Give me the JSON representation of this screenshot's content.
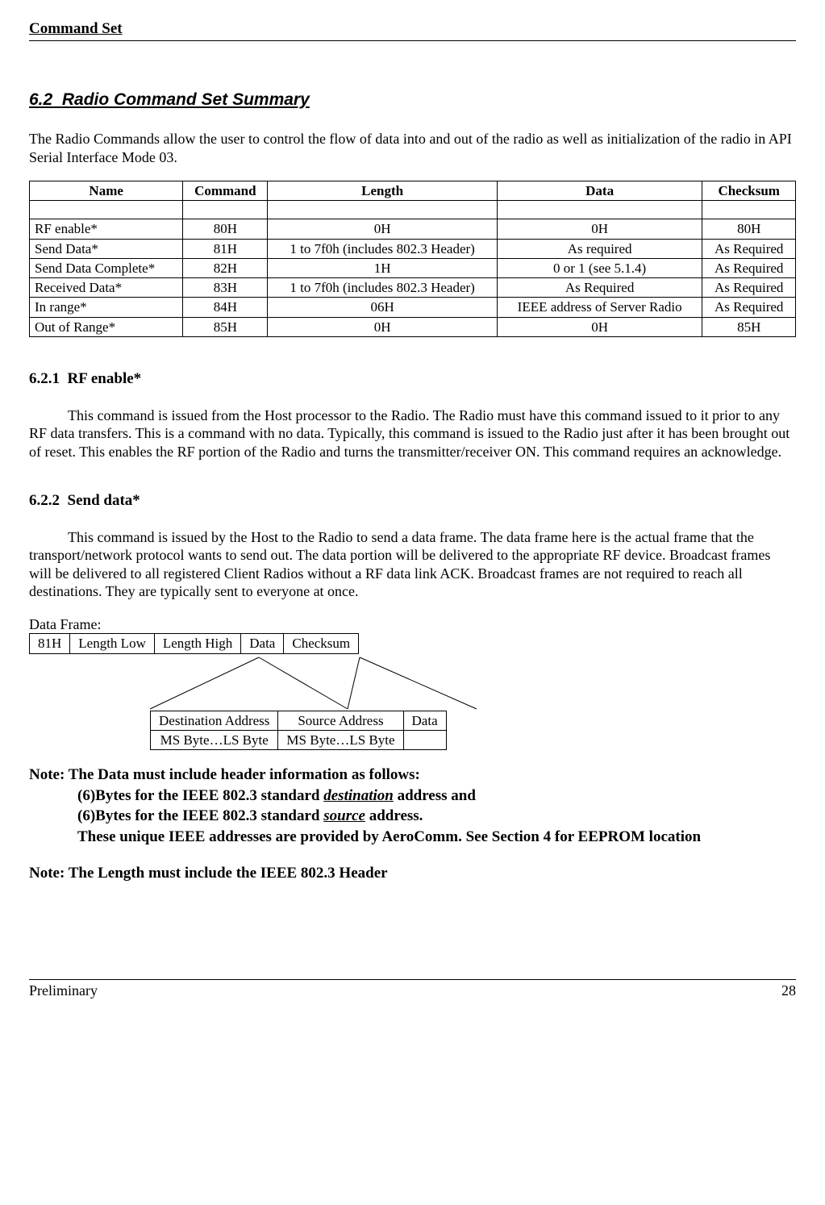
{
  "header": {
    "title": "Command Set"
  },
  "section": {
    "number": "6.2",
    "title": "Radio Command Set Summary",
    "intro": "The Radio Commands allow the user to control the flow of data into and out of the radio as well as initialization of the radio in API Serial Interface Mode 03."
  },
  "table": {
    "headers": [
      "Name",
      "Command",
      "Length",
      "Data",
      "Checksum"
    ],
    "rows": [
      {
        "name": "RF enable*",
        "command": "80H",
        "length": "0H",
        "data": "0H",
        "checksum": "80H"
      },
      {
        "name": "Send Data*",
        "command": "81H",
        "length": "1 to 7f0h (includes 802.3 Header)",
        "data": "As required",
        "checksum": "As Required"
      },
      {
        "name": "Send Data Complete*",
        "command": "82H",
        "length": "1H",
        "data": "0 or 1 (see 5.1.4)",
        "checksum": "As Required"
      },
      {
        "name": "Received Data*",
        "command": "83H",
        "length": "1 to 7f0h (includes 802.3 Header)",
        "data": "As Required",
        "checksum": "As Required"
      },
      {
        "name": "In range*",
        "command": "84H",
        "length": "06H",
        "data": "IEEE address of Server Radio",
        "checksum": "As Required"
      },
      {
        "name": "Out of Range*",
        "command": "85H",
        "length": "0H",
        "data": "0H",
        "checksum": "85H"
      }
    ]
  },
  "sub1": {
    "number": "6.2.1",
    "title": "RF enable*",
    "body": "This command is issued from the Host processor to the Radio. The Radio must have this command issued to it prior to any RF data transfers.  This is a command with no data. Typically, this command is issued to the Radio just after it has been brought out of reset. This enables the RF portion of the Radio and turns the transmitter/receiver ON. This command requires an acknowledge."
  },
  "sub2": {
    "number": "6.2.2",
    "title": "Send data*",
    "body": "This command is issued by the Host to the Radio to send a data frame.  The data frame here is the actual frame that the transport/network protocol wants to send out. The data portion will be delivered to the appropriate RF device. Broadcast frames will be delivered to all registered Client Radios without a RF data link ACK.  Broadcast frames are not required to reach all destinations.  They are typically sent to everyone at once."
  },
  "dataFrame": {
    "label": "Data Frame:",
    "cells": [
      "81H",
      "Length Low",
      "Length High",
      "Data",
      "Checksum"
    ]
  },
  "subTable": {
    "row1": [
      "Destination Address",
      "Source Address",
      "Data"
    ],
    "row2": [
      "MS Byte…LS Byte",
      "MS Byte…LS Byte",
      ""
    ]
  },
  "note1": {
    "lead": "Note: The Data must include header information as follows:",
    "l1a": "(6)Bytes for the IEEE 802.3 standard ",
    "l1u": "destination",
    "l1b": " address and",
    "l2a": "(6)Bytes for the IEEE 802.3 standard ",
    "l2u": "source",
    "l2b": " address.",
    "l3": "These unique IEEE addresses are provided by AeroComm.  See Section 4 for EEPROM location"
  },
  "note2": "Note: The Length must include the IEEE 802.3 Header",
  "footer": {
    "left": "Preliminary",
    "right": "28"
  }
}
